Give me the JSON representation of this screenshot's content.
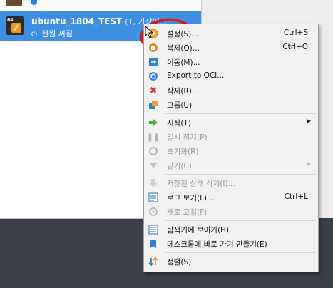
{
  "vm": {
    "name": "ubuntu_1804_TEST",
    "name_suffix": "(1, 가상머...",
    "state": "전원 꺼짐"
  },
  "menu": {
    "settings": {
      "label": "설정(S)...",
      "shortcut": "Ctrl+S"
    },
    "clone": {
      "label": "복제(O)...",
      "shortcut": "Ctrl+O"
    },
    "move": {
      "label": "이동(M)..."
    },
    "export": {
      "label": "Export to OCI..."
    },
    "remove": {
      "label": "삭제(R)..."
    },
    "group": {
      "label": "그룹(U)"
    },
    "start": {
      "label": "시작(T)"
    },
    "pause": {
      "label": "일시 정지(P)"
    },
    "reset": {
      "label": "초기화(R)"
    },
    "close": {
      "label": "닫기(C)"
    },
    "discard": {
      "label": "저장된 상태 삭제(I)..."
    },
    "log": {
      "label": "로그 보기(L)...",
      "shortcut": "Ctrl+L"
    },
    "refresh": {
      "label": "새로 고침(F)"
    },
    "explorer": {
      "label": "탐색기에 보이기(H)"
    },
    "shortcut": {
      "label": "데스크톱에 바로 가기 만들기(E)"
    },
    "sort": {
      "label": "정렬(S)"
    }
  },
  "colors": {
    "selection": "#3f8fe0",
    "annotation": "#d7171a"
  }
}
